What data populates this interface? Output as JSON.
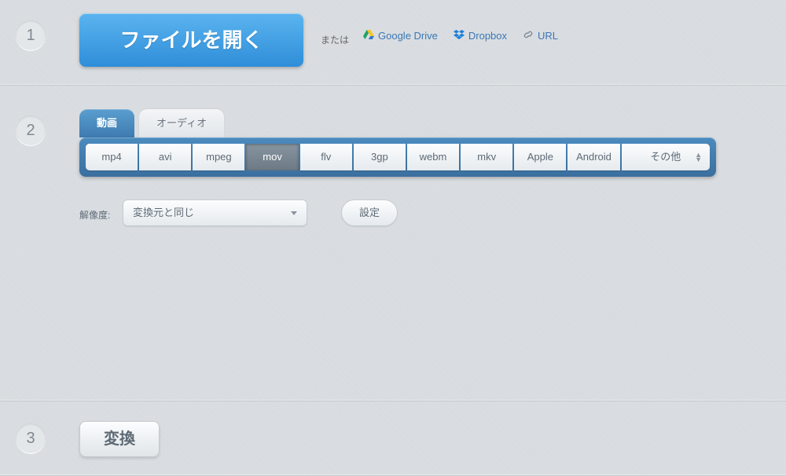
{
  "steps": {
    "s1": "1",
    "s2": "2",
    "s3": "3"
  },
  "open": {
    "button": "ファイルを開く",
    "or": "または",
    "links": {
      "gdrive": "Google Drive",
      "dropbox": "Dropbox",
      "url": "URL"
    }
  },
  "tabs": {
    "video": "動画",
    "audio": "オーディオ"
  },
  "formats": {
    "mp4": "mp4",
    "avi": "avi",
    "mpeg": "mpeg",
    "mov": "mov",
    "flv": "flv",
    "3gp": "3gp",
    "webm": "webm",
    "mkv": "mkv",
    "apple": "Apple",
    "android": "Android",
    "more": "その他",
    "selected": "mov"
  },
  "resolution": {
    "label": "解像度:",
    "value": "変換元と同じ"
  },
  "settings": "設定",
  "convert": "変換"
}
